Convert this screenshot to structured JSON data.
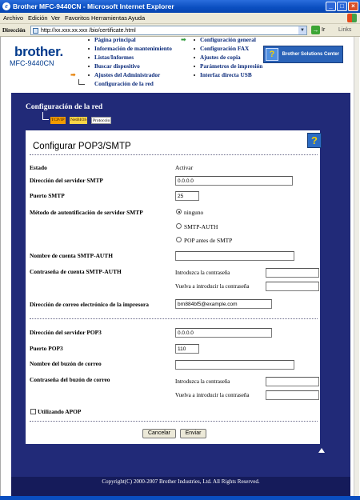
{
  "window": {
    "title": "Brother MFC-9440CN - Microsoft Internet Explorer"
  },
  "menu": [
    "Archivo",
    "Edición",
    "Ver",
    "Favoritos",
    "Herramientas",
    "Ayuda"
  ],
  "address": {
    "label": "Dirección",
    "url": "http://xx.xxx.xx.xxx /bio/certificate.html",
    "go": "Ir",
    "links": "Links"
  },
  "header": {
    "brand": "brother.",
    "model": "MFC-9440CN",
    "nav_left": [
      "Página principal",
      "Información de mantenimiento",
      "Listas/Informes",
      "Buscar dispositivo",
      "Ajustes del Administrador",
      "Configuración de la red"
    ],
    "nav_right": [
      "Configuración general",
      "Configuración FAX",
      "Ajustes de copia",
      "Parámetros de impresión",
      "Interfaz directa USB"
    ],
    "solutions_center": "Brother Solutions Center",
    "solutions_icon": "help-question-icon"
  },
  "panel": {
    "title": "Configuración de la red",
    "crumbs": [
      "TCP/IP",
      "NetBIOS",
      "Protocolo"
    ]
  },
  "form": {
    "title": "Configurar POP3/SMTP",
    "estado_label": "Estado",
    "estado_value": "Activar",
    "smtp_server_label": "Dirección del servidor SMTP",
    "smtp_server_value": "0.0.0.0",
    "smtp_port_label": "Puerto SMTP",
    "smtp_port_value": "25",
    "auth_label": "Método de autentificación de servidor SMTP",
    "auth_options": [
      "ninguno",
      "SMTP-AUTH",
      "POP antes de SMTP"
    ],
    "auth_selected": "ninguno",
    "smtp_account_label": "Nombre de cuenta SMTP-AUTH",
    "smtp_account_value": "",
    "smtp_password_label": "Contraseña de cuenta SMTP-AUTH",
    "enter_password": "Introduzca la contraseña",
    "reenter_password": "Vuelva a introducir la contraseña",
    "printer_email_label": "Dirección de correo electrónico de la impresora",
    "printer_email_value": "brn884bf5@example.com",
    "pop3_server_label": "Dirección del servidor POP3",
    "pop3_server_value": "0.0.0.0",
    "pop3_port_label": "Puerto POP3",
    "pop3_port_value": "110",
    "mailbox_name_label": "Nombre del buzón de correo",
    "mailbox_name_value": "",
    "mailbox_password_label": "Contraseña del buzón de correo",
    "apop_label": "Utilizando APOP",
    "apop_checked": false,
    "cancel": "Cancelar",
    "submit": "Enviar"
  },
  "footer": {
    "copyright": "Copyright(C) 2000-2007 Brother Industries, Ltd. All Rights Reserved."
  }
}
